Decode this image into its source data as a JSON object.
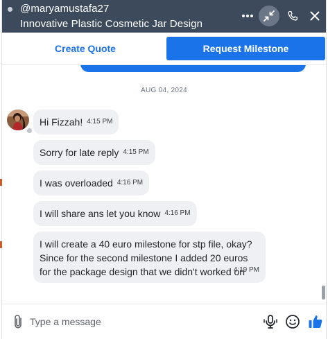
{
  "header": {
    "username": "@maryamustafa27",
    "project_title": "Innovative Plastic Cosmetic Jar Design",
    "icons": [
      "more-icon",
      "minimize-icon",
      "phone-icon",
      "close-icon"
    ]
  },
  "actions": {
    "create_quote": "Create Quote",
    "request_milestone": "Request Milestone"
  },
  "conversation": {
    "date_separator": "AUG 04, 2024",
    "messages": [
      {
        "text": "Hi Fizzah!",
        "time": "4:15 PM"
      },
      {
        "text": "Sorry for late reply",
        "time": "4:15 PM"
      },
      {
        "text": "I was overloaded",
        "time": "4:16 PM"
      },
      {
        "text": "I will share ans let you know",
        "time": "4:16 PM"
      },
      {
        "text": "I will create a 40 euro milestone for stp file, okay? Since for the second milestone I added 20 euros for the package design that we didn't worked on",
        "time": "4:19 PM"
      }
    ]
  },
  "composer": {
    "placeholder": "Type a message",
    "value": ""
  },
  "colors": {
    "header_bg": "#3c4a5c",
    "accent": "#1a73e8",
    "bubble_bg": "#eef0f3"
  }
}
